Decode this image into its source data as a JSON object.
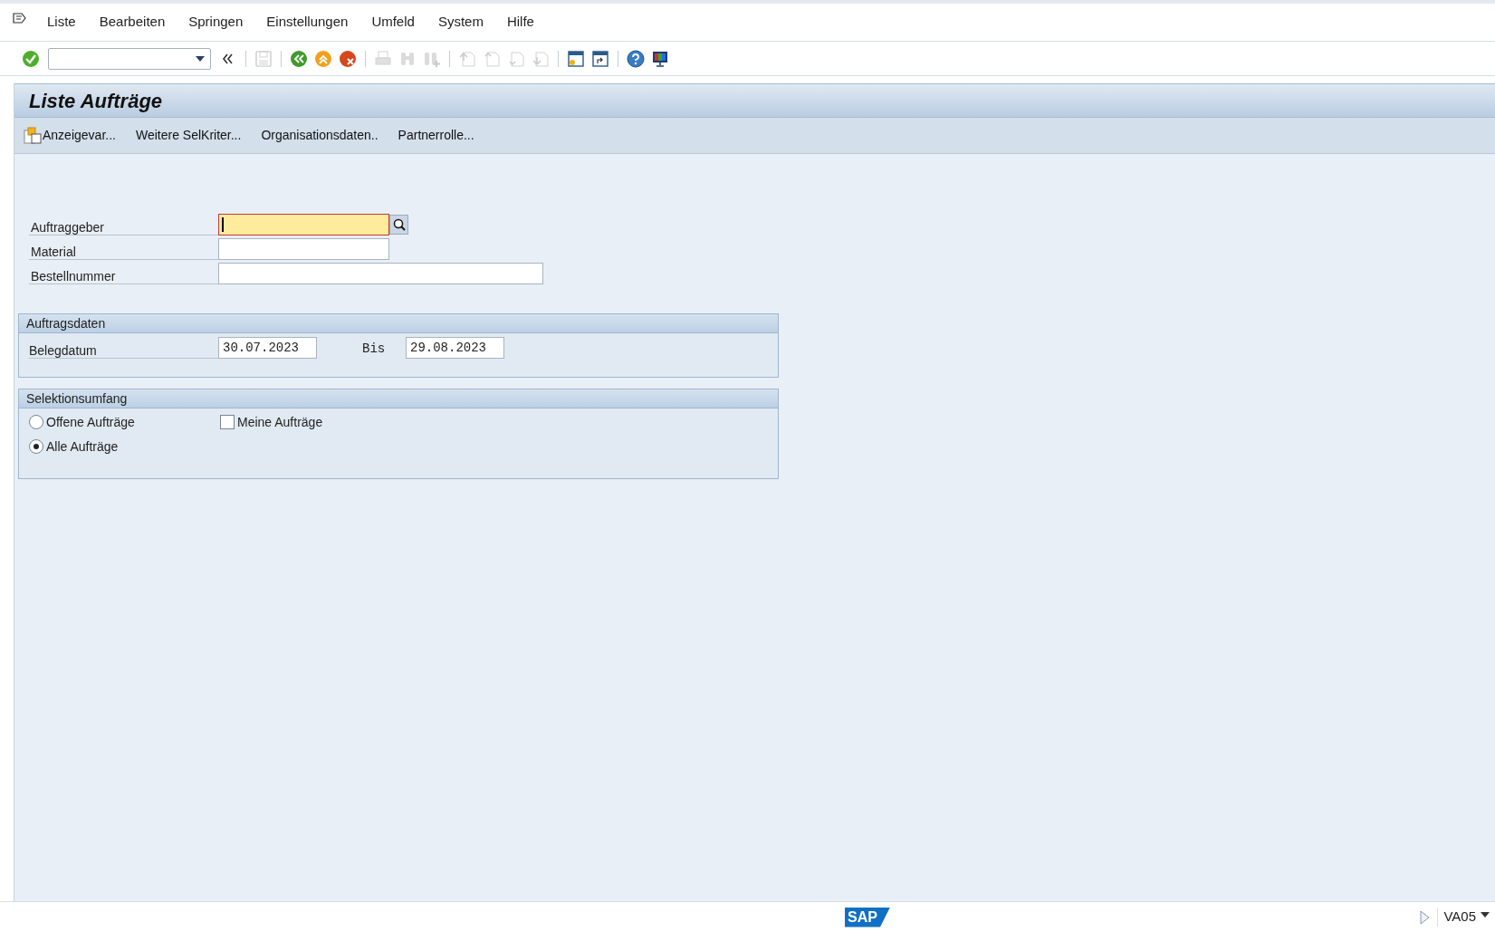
{
  "menu": [
    "Liste",
    "Bearbeiten",
    "Springen",
    "Einstellungen",
    "Umfeld",
    "System",
    "Hilfe"
  ],
  "toolbar": [
    {
      "kind": "enter",
      "disabled": false
    },
    {
      "kind": "command-field"
    },
    {
      "kind": "collapse",
      "disabled": false
    },
    {
      "kind": "sep"
    },
    {
      "kind": "save",
      "disabled": true
    },
    {
      "kind": "sep"
    },
    {
      "kind": "back",
      "disabled": false
    },
    {
      "kind": "exit",
      "disabled": false
    },
    {
      "kind": "cancel",
      "disabled": false
    },
    {
      "kind": "sep"
    },
    {
      "kind": "print",
      "disabled": true
    },
    {
      "kind": "find",
      "disabled": true
    },
    {
      "kind": "find-next",
      "disabled": true
    },
    {
      "kind": "sep"
    },
    {
      "kind": "first-page",
      "disabled": true
    },
    {
      "kind": "prev-page",
      "disabled": true
    },
    {
      "kind": "next-page",
      "disabled": true
    },
    {
      "kind": "last-page",
      "disabled": true
    },
    {
      "kind": "sep"
    },
    {
      "kind": "new-session",
      "disabled": false
    },
    {
      "kind": "shortcut",
      "disabled": false
    },
    {
      "kind": "sep"
    },
    {
      "kind": "help",
      "disabled": false
    },
    {
      "kind": "layout",
      "disabled": false
    }
  ],
  "title": "Liste Aufträge",
  "app_toolbar": [
    {
      "label": "Anzeigevar...",
      "icon": true
    },
    {
      "label": "Weitere SelKriter...",
      "icon": false
    },
    {
      "label": "Organisationsdaten..",
      "icon": false
    },
    {
      "label": "Partnerrolle...",
      "icon": false
    }
  ],
  "fields": [
    {
      "label": "Auftraggeber",
      "kind": "short",
      "focused": true,
      "search_help": true
    },
    {
      "label": "Material",
      "kind": "short",
      "focused": false,
      "search_help": false
    },
    {
      "label": "Bestellnummer",
      "kind": "long",
      "focused": false,
      "search_help": false
    }
  ],
  "groups": [
    {
      "title": "Auftragsdaten",
      "kind": "range",
      "label": "Belegdatum",
      "from": "30.07.2023",
      "to_label": "Bis",
      "to": "29.08.2023"
    },
    {
      "title": "Selektionsumfang",
      "kind": "options",
      "options": [
        {
          "kind": "radio",
          "label": "Offene Aufträge",
          "selected": false
        },
        {
          "kind": "checkbox",
          "label": "Meine Aufträge",
          "checked": false
        },
        {
          "kind": "radio",
          "label": "Alle Aufträge",
          "selected": true
        }
      ]
    }
  ],
  "status_bar": {
    "logo": "SAP",
    "transaction": "VA05"
  }
}
